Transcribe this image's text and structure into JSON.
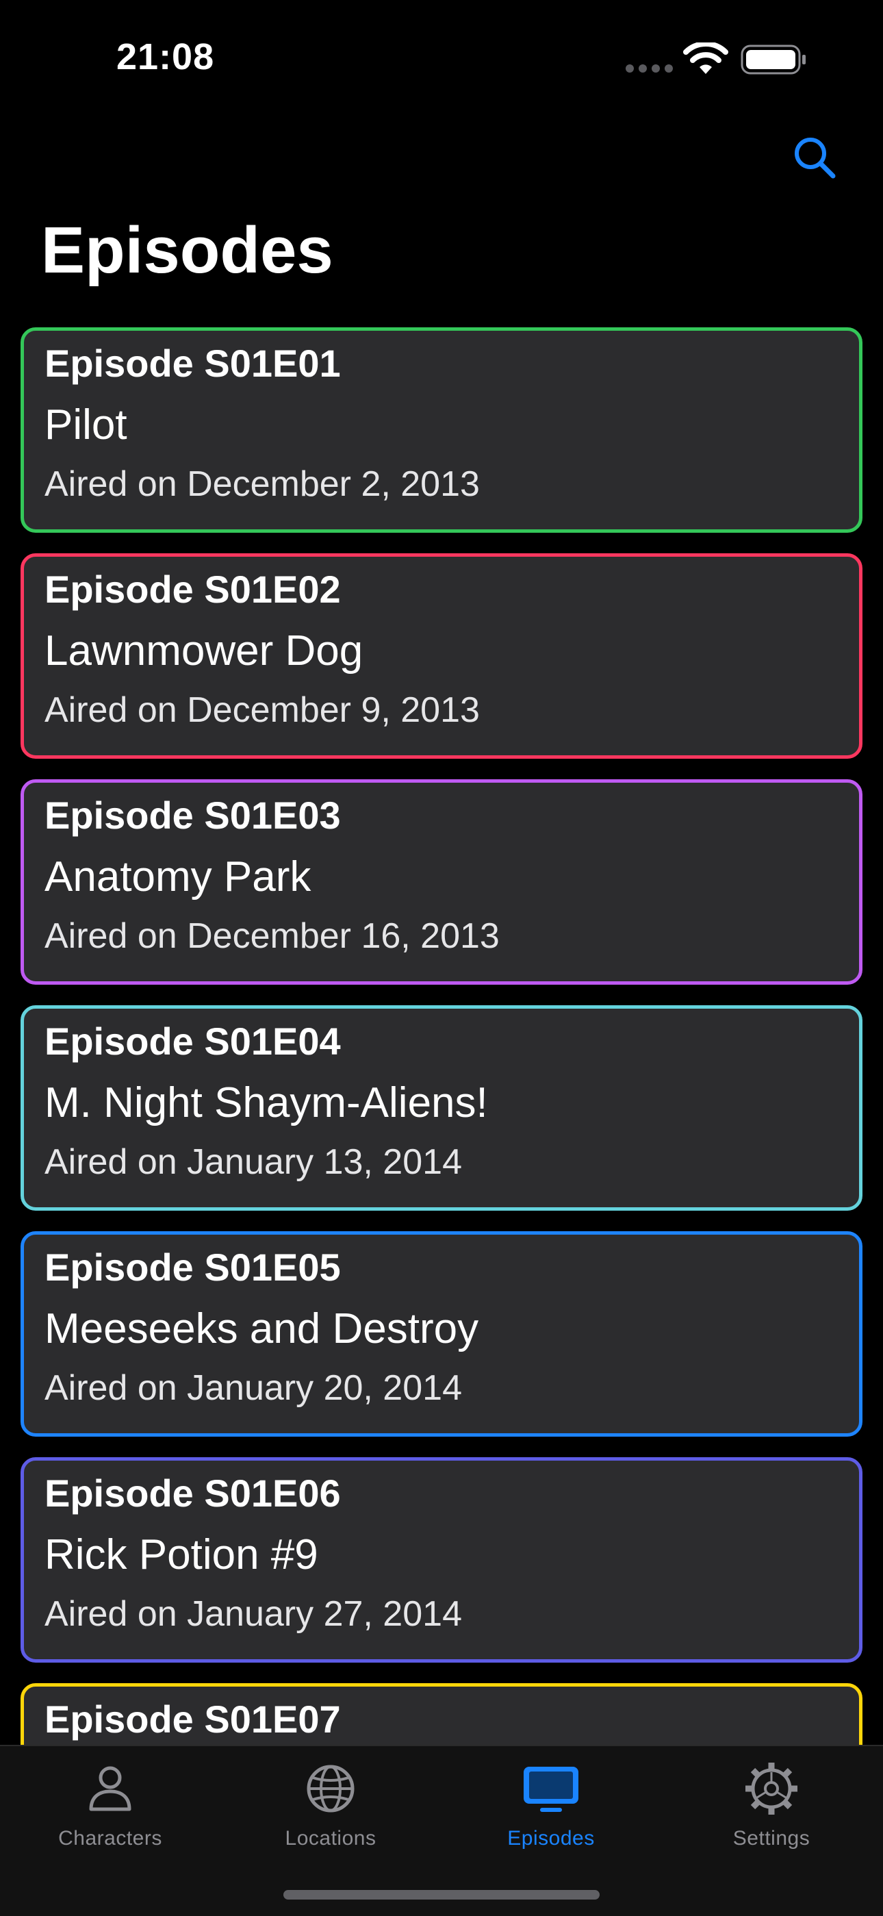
{
  "status_bar": {
    "time": "21:08",
    "icons": [
      "signal-dots-icon",
      "wifi-icon",
      "battery-icon"
    ]
  },
  "header": {
    "title": "Episodes",
    "search_icon": "search-icon"
  },
  "episodes": [
    {
      "code": "Episode S01E01",
      "name": "Pilot",
      "air_date": "Aired on December 2, 2013",
      "color": "#34c759"
    },
    {
      "code": "Episode S01E02",
      "name": "Lawnmower Dog",
      "air_date": "Aired on December 9, 2013",
      "color": "#ff375f"
    },
    {
      "code": "Episode S01E03",
      "name": "Anatomy Park",
      "air_date": "Aired on December 16, 2013",
      "color": "#bf5af2"
    },
    {
      "code": "Episode S01E04",
      "name": "M. Night Shaym-Aliens!",
      "air_date": "Aired on January 13, 2014",
      "color": "#64d2dc"
    },
    {
      "code": "Episode S01E05",
      "name": "Meeseeks and Destroy",
      "air_date": "Aired on January 20, 2014",
      "color": "#1e84ff"
    },
    {
      "code": "Episode S01E06",
      "name": "Rick Potion #9",
      "air_date": "Aired on January 27, 2014",
      "color": "#5e5ce6"
    },
    {
      "code": "Episode S01E07",
      "name": "",
      "air_date": "",
      "color": "#ffd60a"
    }
  ],
  "tab_bar": {
    "tabs": [
      {
        "label": "Characters",
        "icon": "person-icon",
        "active": false
      },
      {
        "label": "Locations",
        "icon": "globe-icon",
        "active": false
      },
      {
        "label": "Episodes",
        "icon": "tv-icon",
        "active": true
      },
      {
        "label": "Settings",
        "icon": "gear-icon",
        "active": false
      }
    ]
  },
  "colors": {
    "accent": "#1a84ff",
    "card_background": "#2c2c2e",
    "inactive_tab": "#8e8e93"
  }
}
